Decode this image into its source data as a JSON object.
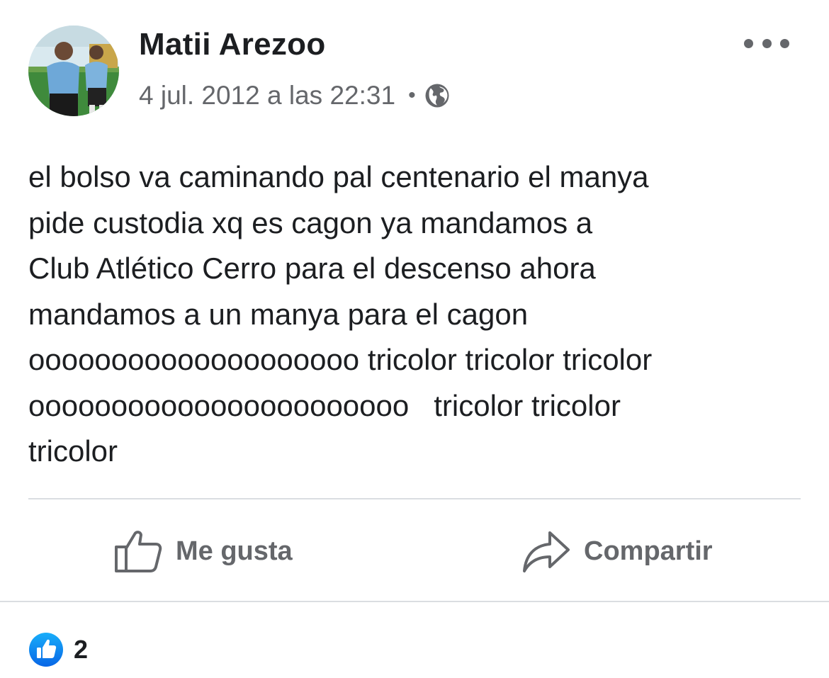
{
  "post": {
    "author": "Matii Arezoo",
    "timestamp": "4 jul. 2012 a las 22:31",
    "separator": "•",
    "privacy_icon": "globe-icon",
    "more_icon": "ellipsis-icon",
    "text": "el bolso va caminando pal centenario el manya\npide custodia xq es cagon ya mandamos a\nClub Atlético Cerro para el descenso ahora\nmandamos a un manya para el cagon\noooooooooooooooooooo tricolor tricolor tricolor\nooooooooooooooooooooooo   tricolor tricolor\ntricolor"
  },
  "actions": {
    "like": {
      "label": "Me gusta",
      "icon": "thumbs-up-outline-icon"
    },
    "share": {
      "label": "Compartir",
      "icon": "share-arrow-icon"
    }
  },
  "reactions": {
    "icon": "like-reaction-icon",
    "count": "2"
  },
  "colors": {
    "text": "#1c1e21",
    "secondary_text": "#65676b",
    "divider": "#dadde1",
    "like_blue": "#1877f2"
  }
}
